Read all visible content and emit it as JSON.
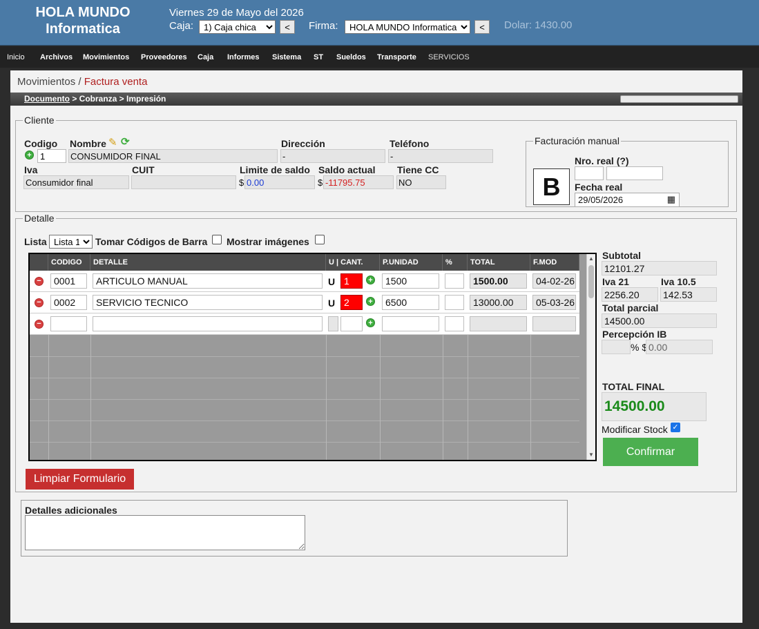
{
  "header": {
    "brand_line1": "HOLA MUNDO",
    "brand_line2": "Informatica",
    "date": "Viernes 29 de Mayo del 2026",
    "caja_label": "Caja:",
    "caja_value": "1) Caja chica",
    "firma_label": "Firma:",
    "firma_value": "HOLA MUNDO Informatica",
    "back_button": "<",
    "dolar": "Dolar: 1430.00"
  },
  "nav": [
    "Inicio",
    "Archivos",
    "Movimientos",
    "Proveedores",
    "Caja",
    "Informes",
    "Sistema",
    "ST",
    "Sueldos",
    "Transporte",
    "SERVICIOS"
  ],
  "breadcrumb": {
    "section": "Movimientos",
    "sep": " / ",
    "current": "Factura venta"
  },
  "steps": {
    "s1": "Documento",
    "s2": " > Cobranza > Impresión"
  },
  "cliente": {
    "legend": "Cliente",
    "codigo_label": "Codigo",
    "codigo_value": "1",
    "nombre_label": "Nombre",
    "nombre_value": "CONSUMIDOR FINAL",
    "direccion_label": "Dirección",
    "direccion_value": "-",
    "telefono_label": "Teléfono",
    "telefono_value": "-",
    "iva_label": "Iva",
    "iva_value": "Consumidor final",
    "cuit_label": "CUIT",
    "cuit_value": "",
    "limite_label": "Limite de saldo",
    "limite_value": "0.00",
    "saldo_label": "Saldo actual",
    "saldo_value": "-11795.75",
    "tienecc_label": "Tiene CC",
    "tienecc_value": "NO",
    "currency": "$"
  },
  "facturacion": {
    "legend": "Facturación manual",
    "tipo": "B",
    "nro_label": "Nro. real (?)",
    "fecha_label": "Fecha real",
    "fecha_value": "29/05/2026"
  },
  "detalle": {
    "legend": "Detalle",
    "lista_label": "Lista",
    "lista_value": "Lista 1",
    "barcode_label": "Tomar Códigos de Barra",
    "images_label": "Mostrar imágenes",
    "columns": [
      "CODIGO",
      "DETALLE",
      "U | CANT.",
      "P.UNIDAD",
      "%",
      "TOTAL",
      "F.MOD"
    ],
    "rows": [
      {
        "codigo": "0001",
        "detalle": "ARTICULO MANUAL",
        "u": "U",
        "cant": "1",
        "punidad": "1500",
        "pct": "",
        "total": "1500.00",
        "fmod": "04-02-26"
      },
      {
        "codigo": "0002",
        "detalle": "SERVICIO TECNICO",
        "u": "U",
        "cant": "2",
        "punidad": "6500",
        "pct": "",
        "total": "13000.00",
        "fmod": "05-03-26"
      }
    ],
    "clear_button": "Limpiar Formulario"
  },
  "totals": {
    "subtotal_label": "Subtotal",
    "subtotal": "12101.27",
    "iva21_label": "Iva 21",
    "iva21": "2256.20",
    "iva105_label": "Iva 10.5",
    "iva105": "142.53",
    "parcial_label": "Total parcial",
    "parcial": "14500.00",
    "percepcion_label": "Percepción IB",
    "percepcion_pct_sign": "% $",
    "percepcion_value": "0.00",
    "final_label": "TOTAL FINAL",
    "final": "14500.00",
    "stock_label": "Modificar Stock",
    "confirm_button": "Confirmar"
  },
  "adicionales": {
    "label": "Detalles adicionales",
    "value": ""
  },
  "colors": {
    "header_bg": "#4a7aa6",
    "nav_bg": "#222222",
    "confirm": "#4caf50",
    "clear": "#c62f2f",
    "total_final": "#1a8a1a",
    "negative": "#d42020",
    "limit": "#1a3ad4"
  }
}
